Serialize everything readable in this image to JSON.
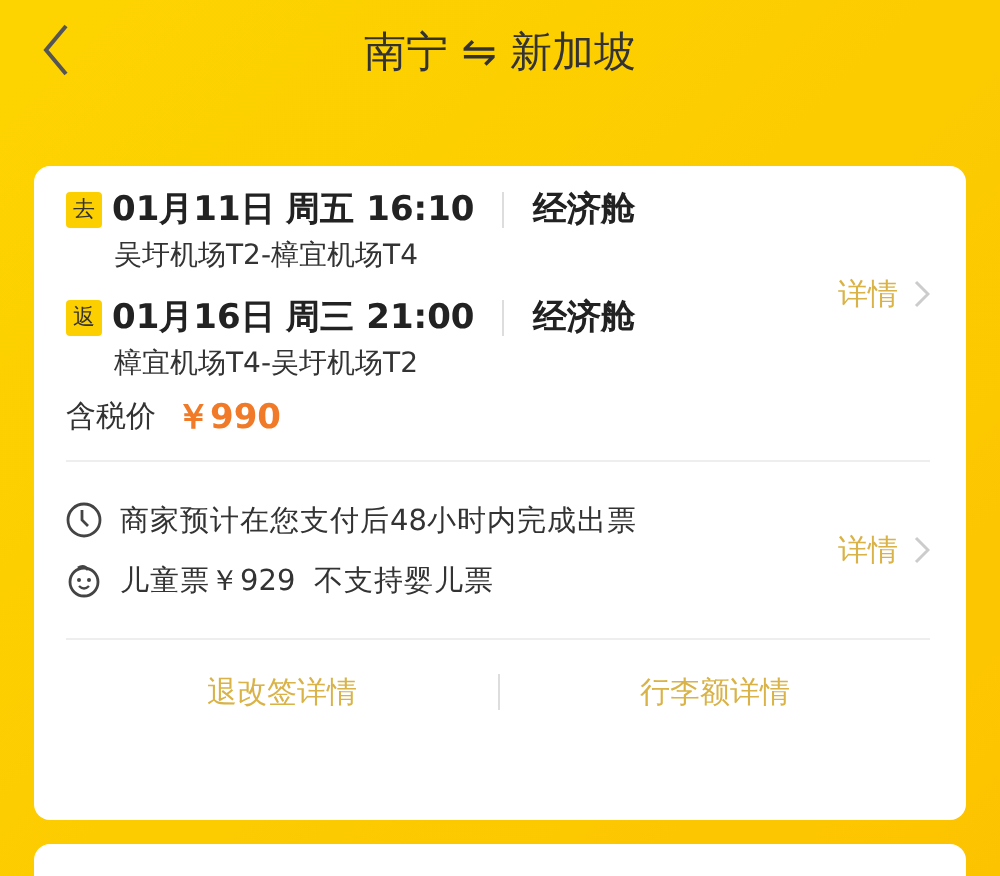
{
  "header": {
    "title": "南宁 ⇋ 新加坡"
  },
  "trip": {
    "legs": [
      {
        "badge": "去",
        "datetime": "01月11日 周五 16:10",
        "cabin": "经济舱",
        "route": "吴圩机场T2-樟宜机场T4"
      },
      {
        "badge": "返",
        "datetime": "01月16日 周三 21:00",
        "cabin": "经济舱",
        "route": "樟宜机场T4-吴圩机场T2"
      }
    ],
    "details_link": "详情",
    "price_label": "含税价",
    "price": "￥990"
  },
  "notes": {
    "items": [
      {
        "kind": "clock",
        "text": "商家预计在您支付后48小时内完成出票"
      },
      {
        "kind": "child",
        "text": "儿童票￥929  不支持婴儿票"
      }
    ],
    "details_link": "详情"
  },
  "footer_links": [
    "退改签详情",
    "行李额详情"
  ]
}
